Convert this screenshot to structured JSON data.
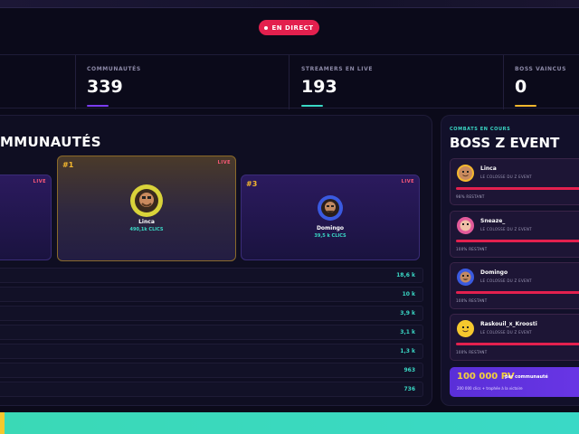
{
  "live_badge": {
    "label": "EN DIRECT"
  },
  "stats": [
    {
      "label": "COMMUNAUTÉS",
      "value": "339",
      "color": "#7b3cf0"
    },
    {
      "label": "STREAMERS EN LIVE",
      "value": "193",
      "color": "#3ad9c6"
    },
    {
      "label": "BOSS VAINCUS",
      "value": "0",
      "color": "#f5b82e"
    }
  ],
  "communities": {
    "title": "MMUNAUTÉS",
    "live_tag": "LIVE",
    "podium": [
      {
        "rank": "#1",
        "name": "Linca",
        "clicks": "490,1k CLICS"
      },
      {
        "rank": "#3",
        "name": "Domingo",
        "clicks": "39,5 k CLICS"
      }
    ],
    "rows": [
      "18,6 k",
      "10 k",
      "3,9 k",
      "3,1 k",
      "1,3 k",
      "963",
      "736"
    ]
  },
  "boss_panel": {
    "eyebrow": "COMBATS EN COURS",
    "title": "BOSS Z EVENT",
    "subtitle": "LE COLOSSE DU Z EVENT",
    "fights": [
      {
        "name": "Linca",
        "percent": "98% RESTANT"
      },
      {
        "name": "Sneaze_",
        "percent": "100% RESTANT"
      },
      {
        "name": "Domingo",
        "percent": "100% RESTANT"
      },
      {
        "name": "Raskouil_x_Kroosti",
        "percent": "100% RESTANT"
      }
    ],
    "hp_box": {
      "big": "100 000 PV",
      "small": "par communauté",
      "sub": "200 000 clics + trophée à la victoire"
    }
  },
  "colors": {
    "accent_red": "#e3204e",
    "accent_teal": "#3ad9c6",
    "accent_gold": "#f5b82e",
    "accent_purple": "#6a36e6"
  }
}
